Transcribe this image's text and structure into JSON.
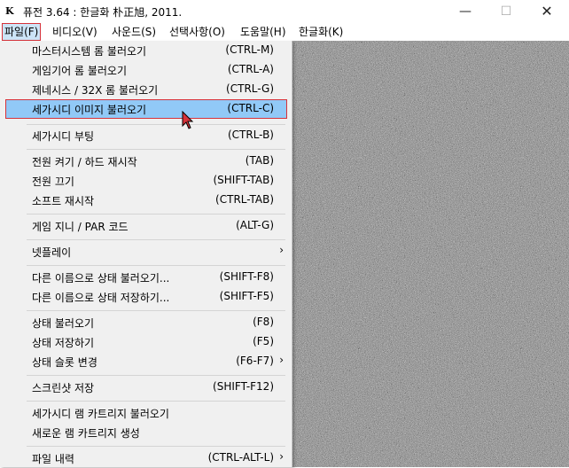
{
  "window": {
    "title": "퓨전 3.64 : 한글화 朴正旭, 2011.",
    "icon": "app-icon",
    "controls": {
      "minimize": "—",
      "maximize": "☐",
      "close": "✕"
    }
  },
  "menubar": [
    "파일(F)",
    "비디오(V)",
    "사운드(S)",
    "선택사항(O)",
    "도움말(H)",
    "한글화(K)"
  ],
  "menu": {
    "items": [
      {
        "label": "마스터시스템 롬 불러오기",
        "shortcut": "(CTRL-M)"
      },
      {
        "label": "게임기어 롬 불러오기",
        "shortcut": "(CTRL-A)"
      },
      {
        "label": "제네시스 / 32X 롬 불러오기",
        "shortcut": "(CTRL-G)"
      },
      {
        "label": "세가시디 이미지 불러오기",
        "shortcut": "(CTRL-C)"
      },
      {
        "label": "세가시디 부팅",
        "shortcut": "(CTRL-B)"
      },
      {
        "label": "전원 켜기 / 하드 재시작",
        "shortcut": "(TAB)"
      },
      {
        "label": "전원 끄기",
        "shortcut": "(SHIFT-TAB)"
      },
      {
        "label": "소프트 재시작",
        "shortcut": "(CTRL-TAB)"
      },
      {
        "label": "게임 지니 / PAR 코드",
        "shortcut": "(ALT-G)"
      },
      {
        "label": "넷플레이",
        "shortcut": "",
        "submenu": "›"
      },
      {
        "label": "다른 이름으로 상태 불러오기...",
        "shortcut": "(SHIFT-F8)"
      },
      {
        "label": "다른 이름으로 상태 저장하기...",
        "shortcut": "(SHIFT-F5)"
      },
      {
        "label": "상태 불러오기",
        "shortcut": "(F8)"
      },
      {
        "label": "상태 저장하기",
        "shortcut": "(F5)"
      },
      {
        "label": "상태 슬롯 변경",
        "shortcut": "(F6-F7)",
        "submenu": "›"
      },
      {
        "label": "스크린샷 저장",
        "shortcut": "(SHIFT-F12)"
      },
      {
        "label": "세가시디 램 카트리지 불러오기",
        "shortcut": ""
      },
      {
        "label": "새로운 램 카트리지 생성",
        "shortcut": ""
      },
      {
        "label": "파일 내력",
        "shortcut": "(CTRL-ALT-L)",
        "submenu": "›"
      }
    ]
  },
  "colors": {
    "highlight": "#91c9f7",
    "highlight_border": "#d6323a",
    "menu_bg": "#f0f0f0"
  }
}
